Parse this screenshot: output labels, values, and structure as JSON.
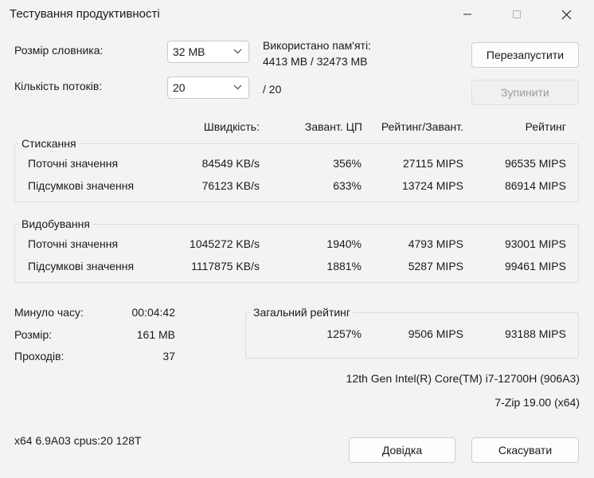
{
  "window": {
    "title": "Тестування продуктивності"
  },
  "icons": {
    "minimize": "minimize-icon",
    "maximize": "maximize-icon",
    "close": "close-icon",
    "chevron": "chevron-down-icon"
  },
  "settings": {
    "dict_label": "Розмір словника:",
    "dict_value": "32 MB",
    "threads_label": "Кількість потоків:",
    "threads_value": "20",
    "threads_total": "/ 20",
    "memory_label": "Використано пам'яті:",
    "memory_value": "4413 MB / 32473 MB"
  },
  "buttons": {
    "restart": "Перезапустити",
    "stop": "Зупинити",
    "help": "Довідка",
    "cancel": "Скасувати"
  },
  "columns": {
    "speed": "Швидкість:",
    "cpu_load": "Завант. ЦП",
    "rating_per_load": "Рейтинг/Завант.",
    "rating": "Рейтинг"
  },
  "compression": {
    "title": "Стискання",
    "current": {
      "label": "Поточні значення",
      "speed": "84549 KB/s",
      "cpu": "356%",
      "rpu": "27115 MIPS",
      "rating": "96535 MIPS"
    },
    "total": {
      "label": "Підсумкові значення",
      "speed": "76123 KB/s",
      "cpu": "633%",
      "rpu": "13724 MIPS",
      "rating": "86914 MIPS"
    }
  },
  "decompression": {
    "title": "Видобування",
    "current": {
      "label": "Поточні значення",
      "speed": "1045272 KB/s",
      "cpu": "1940%",
      "rpu": "4793 MIPS",
      "rating": "93001 MIPS"
    },
    "total": {
      "label": "Підсумкові значення",
      "speed": "1117875 KB/s",
      "cpu": "1881%",
      "rpu": "5287 MIPS",
      "rating": "99461 MIPS"
    }
  },
  "stats": {
    "elapsed_label": "Минуло часу:",
    "elapsed_value": "00:04:42",
    "size_label": "Розмір:",
    "size_value": "161 MB",
    "passes_label": "Проходів:",
    "passes_value": "37"
  },
  "overall": {
    "title": "Загальний рейтинг",
    "cpu": "1257%",
    "rpu": "9506 MIPS",
    "rating": "93188 MIPS"
  },
  "system": {
    "cpu_name": "12th Gen Intel(R) Core(TM) i7-12700H (906A3)",
    "app_version": "7-Zip 19.00 (x64)",
    "build_info": "x64 6.9A03 cpus:20 128T"
  }
}
